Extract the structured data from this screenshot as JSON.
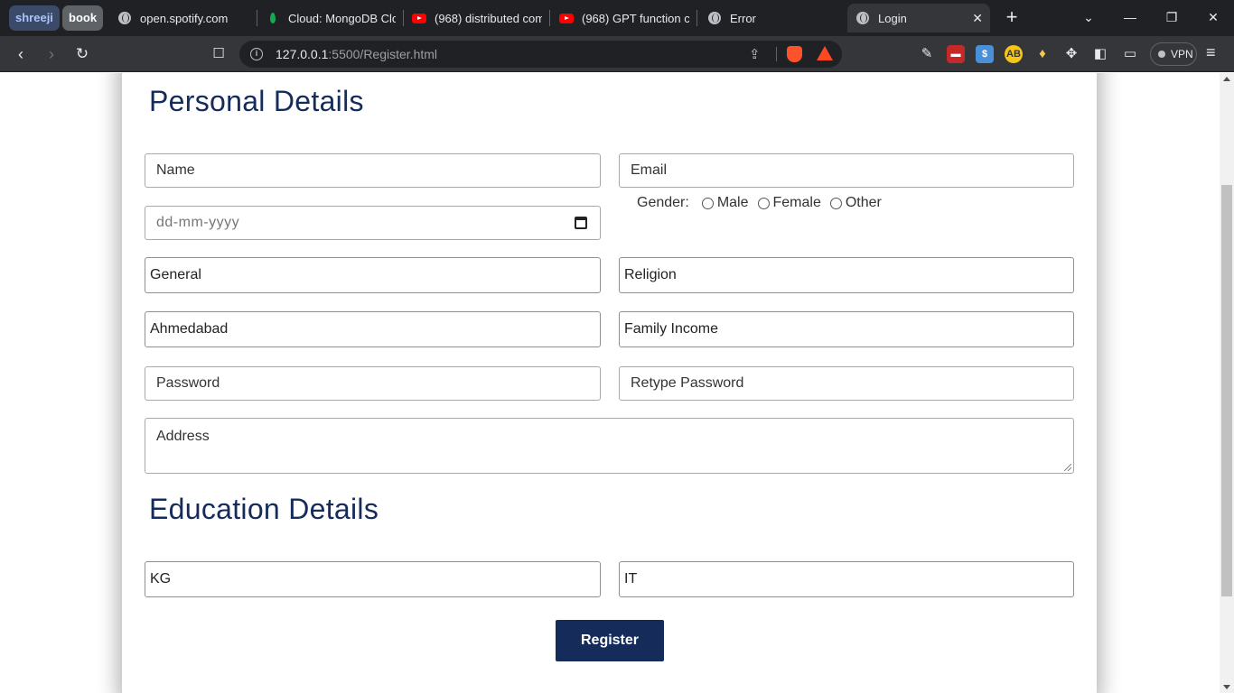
{
  "browser": {
    "tab_groups": [
      {
        "label": "shreeji"
      },
      {
        "label": "book"
      }
    ],
    "tabs": [
      {
        "title": "open.spotify.com",
        "icon": "globe-icon"
      },
      {
        "title": "Cloud: MongoDB Clou",
        "icon": "mongodb-leaf-icon"
      },
      {
        "title": "(968) distributed comp",
        "icon": "youtube-icon"
      },
      {
        "title": "(968) GPT function call",
        "icon": "youtube-icon"
      },
      {
        "title": "Error",
        "icon": "globe-icon"
      },
      {
        "title": "Login",
        "icon": "globe-icon",
        "active": true
      }
    ],
    "url_host": "127.0.0.1",
    "url_rest": ":5500/Register.html",
    "vpn_label": "VPN",
    "accent": "#202124"
  },
  "form": {
    "personal_title": "Personal Details",
    "name_placeholder": "Name",
    "email_placeholder": "Email",
    "dob_placeholder": "dd-mm-yyyy",
    "gender_label": "Gender:",
    "gender_options": [
      "Male",
      "Female",
      "Other"
    ],
    "category_value": "General",
    "religion_value": "Religion",
    "city_value": "Ahmedabad",
    "income_value": "Family Income",
    "password_placeholder": "Password",
    "retype_placeholder": "Retype Password",
    "address_placeholder": "Address",
    "education_title": "Education Details",
    "education_level_value": "KG",
    "stream_value": "IT",
    "register_label": "Register",
    "brand_color": "#152c5b"
  }
}
